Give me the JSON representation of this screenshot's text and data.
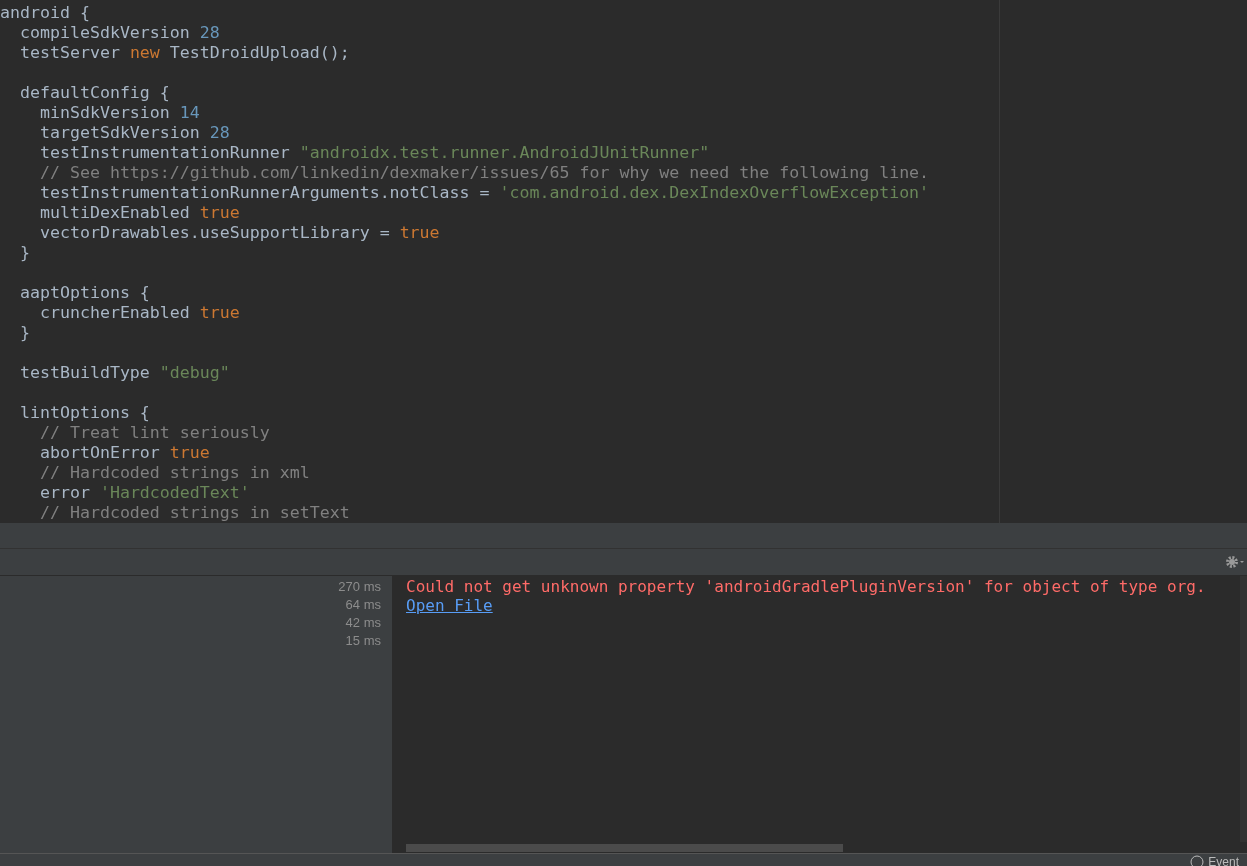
{
  "editor": {
    "lines": [
      [
        {
          "kind": "plain",
          "text": "android {"
        }
      ],
      [
        {
          "kind": "plain",
          "text": "  compileSdkVersion "
        },
        {
          "kind": "number",
          "text": "28"
        }
      ],
      [
        {
          "kind": "plain",
          "text": "  testServer "
        },
        {
          "kind": "keyword",
          "text": "new"
        },
        {
          "kind": "plain",
          "text": " TestDroidUpload();"
        }
      ],
      {
        "kind": "blank"
      },
      [
        {
          "kind": "plain",
          "text": "  defaultConfig {"
        }
      ],
      [
        {
          "kind": "plain",
          "text": "    minSdkVersion "
        },
        {
          "kind": "number",
          "text": "14"
        }
      ],
      [
        {
          "kind": "plain",
          "text": "    targetSdkVersion "
        },
        {
          "kind": "number",
          "text": "28"
        }
      ],
      [
        {
          "kind": "plain",
          "text": "    testInstrumentationRunner "
        },
        {
          "kind": "string",
          "text": "\"androidx.test.runner.AndroidJUnitRunner\""
        }
      ],
      [
        {
          "kind": "comment",
          "text": "    // See https://github.com/linkedin/dexmaker/issues/65 for why we need the following line."
        }
      ],
      [
        {
          "kind": "plain",
          "text": "    testInstrumentationRunnerArguments.notClass = "
        },
        {
          "kind": "string",
          "text": "'com.android.dex.DexIndexOverflowException'"
        }
      ],
      [
        {
          "kind": "plain",
          "text": "    multiDexEnabled "
        },
        {
          "kind": "keyword",
          "text": "true"
        }
      ],
      [
        {
          "kind": "plain",
          "text": "    vectorDrawables.useSupportLibrary = "
        },
        {
          "kind": "keyword",
          "text": "true"
        }
      ],
      [
        {
          "kind": "plain",
          "text": "  }"
        }
      ],
      {
        "kind": "blank"
      },
      [
        {
          "kind": "plain",
          "text": "  aaptOptions {"
        }
      ],
      [
        {
          "kind": "plain",
          "text": "    cruncherEnabled "
        },
        {
          "kind": "keyword",
          "text": "true"
        }
      ],
      [
        {
          "kind": "plain",
          "text": "  }"
        }
      ],
      {
        "kind": "blank"
      },
      [
        {
          "kind": "plain",
          "text": "  testBuildType "
        },
        {
          "kind": "string",
          "text": "\"debug\""
        }
      ],
      {
        "kind": "blank"
      },
      [
        {
          "kind": "plain",
          "text": "  lintOptions {"
        }
      ],
      [
        {
          "kind": "comment",
          "text": "    // Treat lint seriously"
        }
      ],
      [
        {
          "kind": "plain",
          "text": "    abortOnError "
        },
        {
          "kind": "keyword",
          "text": "true"
        }
      ],
      [
        {
          "kind": "comment",
          "text": "    // Hardcoded strings in xml"
        }
      ],
      [
        {
          "kind": "plain",
          "text": "    error "
        },
        {
          "kind": "string",
          "text": "'HardcodedText'"
        }
      ],
      [
        {
          "kind": "comment",
          "text": "    // Hardcoded strings in setText"
        }
      ]
    ]
  },
  "build_panel": {
    "timings": [
      "270 ms",
      "64 ms",
      "42 ms",
      "15 ms"
    ],
    "error": "Could not get unknown property 'androidGradlePluginVersion' for object of type org.",
    "link": "Open File"
  },
  "status_bar": {
    "event_log": "Event"
  }
}
